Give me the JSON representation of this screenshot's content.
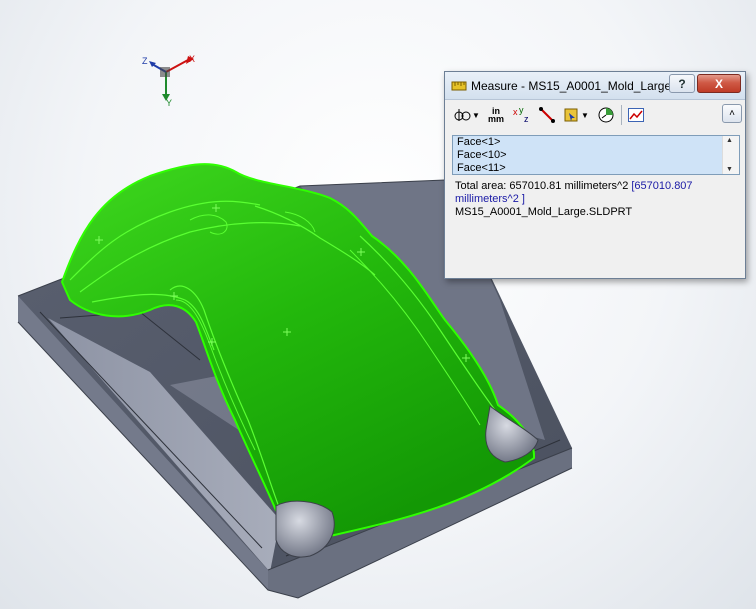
{
  "axes": {
    "x": "X",
    "y": "Y",
    "z": "Z"
  },
  "dialog": {
    "title": "Measure - MS15_A0001_Mold_Large",
    "help_label": "?",
    "close_label": "X",
    "toolbar": {
      "units_in": "in",
      "units_mm": "mm",
      "collapse_label": "˄"
    },
    "selections": [
      "Face<1>",
      "Face<10>",
      "Face<11>"
    ],
    "result": {
      "area_text": "Total area: 657010.81 millimeters^2",
      "alt_area_text": "[657010.807 millimeters^2 ]",
      "file_name": "MS15_A0001_Mold_Large.SLDPRT"
    }
  },
  "colors": {
    "face_highlight": "#22cc00",
    "mold_base": "#5c6272",
    "dialog_bg": "#f0f0f0",
    "selection_bg": "#cfe3f7"
  }
}
